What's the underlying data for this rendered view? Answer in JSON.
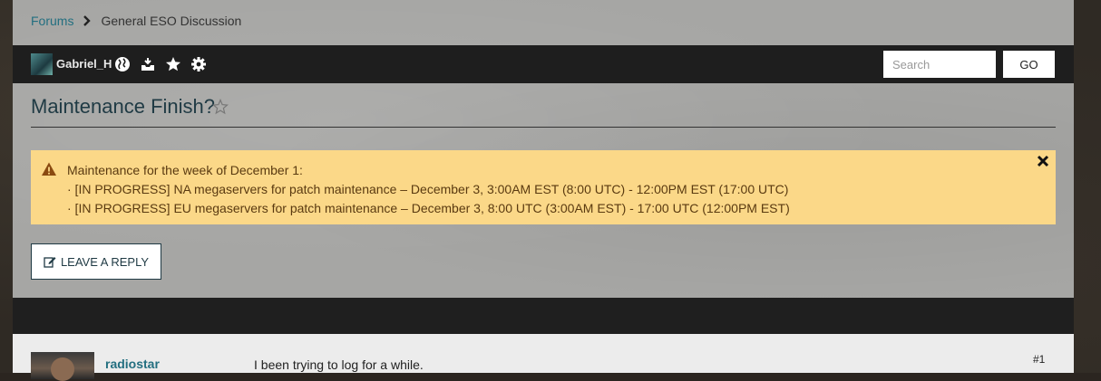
{
  "breadcrumb": {
    "forums_label": "Forums",
    "current_label": "General ESO Discussion"
  },
  "toolbar": {
    "username": "Gabriel_H",
    "icons": [
      "globe-icon",
      "inbox-icon",
      "star-icon",
      "gear-icon"
    ],
    "search_placeholder": "Search",
    "go_label": "GO"
  },
  "thread": {
    "title": "Maintenance Finish?"
  },
  "alert": {
    "line1": "Maintenance for the week of December 1:",
    "line2": "· [IN PROGRESS] NA megaservers for patch maintenance – December 3, 3:00AM EST (8:00 UTC) - 12:00PM EST (17:00 UTC)",
    "line3": "· [IN PROGRESS] EU megaservers for patch maintenance – December 3, 8:00 UTC (3:00AM EST) - 17:00 UTC (12:00PM EST)"
  },
  "reply_button": {
    "label": "LEAVE A REPLY"
  },
  "post": {
    "author": "radiostar",
    "body": "I been trying to log for a while.",
    "number": "#1"
  },
  "colors": {
    "accent": "#236f80",
    "alert_bg": "#fbd888",
    "toolbar_bg": "#1e1e1e",
    "title": "#1f3a44"
  }
}
